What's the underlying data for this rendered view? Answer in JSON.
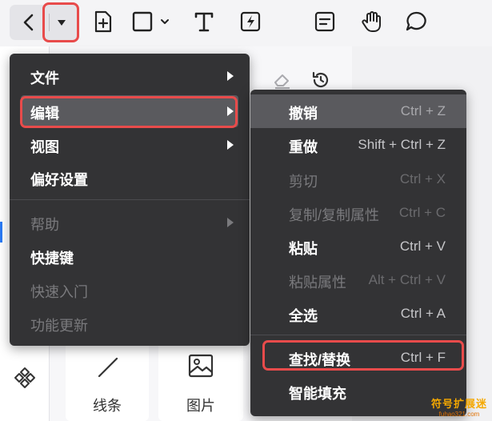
{
  "toolbar": {
    "items": [
      "back-icon",
      "dropdown-icon",
      "add-page-icon",
      "shape-icon",
      "text-icon",
      "flash-icon",
      "sticky-note-icon",
      "hand-icon",
      "comment-icon"
    ]
  },
  "main_menu": {
    "items": [
      {
        "label": "文件",
        "has_submenu": true,
        "enabled": true
      },
      {
        "label": "编辑",
        "has_submenu": true,
        "enabled": true,
        "active": true
      },
      {
        "label": "视图",
        "has_submenu": true,
        "enabled": true
      },
      {
        "label": "偏好设置",
        "has_submenu": false,
        "enabled": true
      },
      {
        "label": "帮助",
        "has_submenu": true,
        "enabled": false
      },
      {
        "label": "快捷键",
        "has_submenu": false,
        "enabled": true
      },
      {
        "label": "快速入门",
        "has_submenu": false,
        "enabled": false
      },
      {
        "label": "功能更新",
        "has_submenu": false,
        "enabled": false
      }
    ]
  },
  "edit_submenu": {
    "items": [
      {
        "label": "撤销",
        "shortcut": "Ctrl + Z",
        "enabled": true,
        "hovered": true
      },
      {
        "label": "重做",
        "shortcut": "Shift + Ctrl + Z",
        "enabled": true
      },
      {
        "label": "剪切",
        "shortcut": "Ctrl + X",
        "enabled": false
      },
      {
        "label": "复制/复制属性",
        "shortcut": "Ctrl + C",
        "enabled": false
      },
      {
        "label": "粘贴",
        "shortcut": "Ctrl + V",
        "enabled": true
      },
      {
        "label": "粘贴属性",
        "shortcut": "Alt + Ctrl + V",
        "enabled": false
      },
      {
        "label": "全选",
        "shortcut": "Ctrl + A",
        "enabled": true
      },
      {
        "label": "查找/替换",
        "shortcut": "Ctrl + F",
        "enabled": true
      },
      {
        "label": "智能填充",
        "shortcut": "",
        "enabled": true
      }
    ]
  },
  "panel": {
    "tiles": [
      {
        "label": "线条",
        "icon": "line-icon"
      },
      {
        "label": "图片",
        "icon": "image-icon"
      }
    ]
  },
  "watermark": {
    "main": "符号扩展迷",
    "sub": "fuhao321.com"
  },
  "colors": {
    "menu_bg": "#333335",
    "active_bg": "#5a5a5e",
    "highlight": "#e84b4b",
    "accent": "#2b7bf5"
  }
}
